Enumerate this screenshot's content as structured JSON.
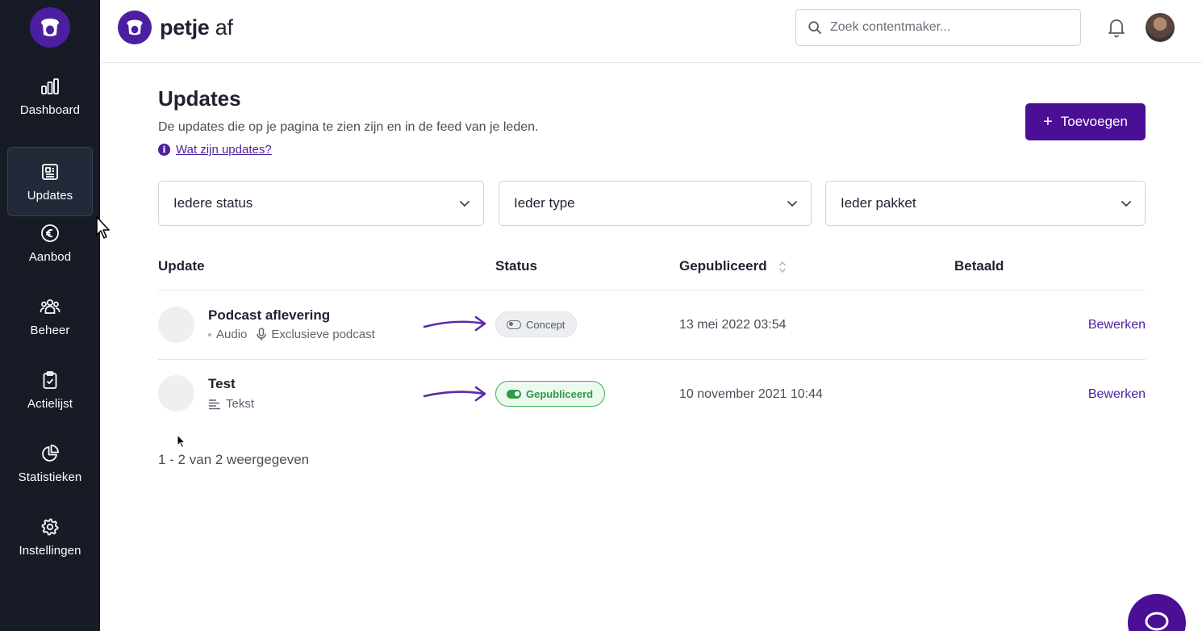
{
  "brand": {
    "name": "petje",
    "suffix": "af"
  },
  "search": {
    "placeholder": "Zoek contentmaker..."
  },
  "sidebar": {
    "items": [
      {
        "label": "Dashboard",
        "icon": "bar-chart-icon"
      },
      {
        "label": "Updates",
        "icon": "newspaper-icon",
        "active": true
      },
      {
        "label": "Aanbod",
        "icon": "euro-icon"
      },
      {
        "label": "Beheer",
        "icon": "users-icon"
      },
      {
        "label": "Actielijst",
        "icon": "clipboard-check-icon"
      },
      {
        "label": "Statistieken",
        "icon": "pie-chart-icon"
      },
      {
        "label": "Instellingen",
        "icon": "gear-icon"
      }
    ]
  },
  "header": {
    "title": "Updates",
    "subtitle": "De updates die op je pagina te zien zijn en in de feed van je leden.",
    "help_link": "Wat zijn updates?",
    "add_button": "Toevoegen"
  },
  "filters": {
    "status": "Iedere status",
    "type": "Ieder type",
    "package": "Ieder pakket"
  },
  "table": {
    "columns": [
      "Update",
      "Status",
      "Gepubliceerd",
      "Betaald"
    ],
    "rows": [
      {
        "title": "Podcast aflevering",
        "type": "Audio",
        "extra": "Exclusieve podcast",
        "status": "Concept",
        "published": "13 mei 2022 03:54",
        "action": "Bewerken"
      },
      {
        "title": "Test",
        "type": "Tekst",
        "status": "Gepubliceerd",
        "published": "10 november 2021 10:44",
        "action": "Bewerken"
      }
    ],
    "summary": "1 - 2 van 2 weergegeven"
  },
  "colors": {
    "brand_purple": "#4b0f96",
    "sidebar_bg": "#161b26",
    "published_green": "#3bb155"
  }
}
